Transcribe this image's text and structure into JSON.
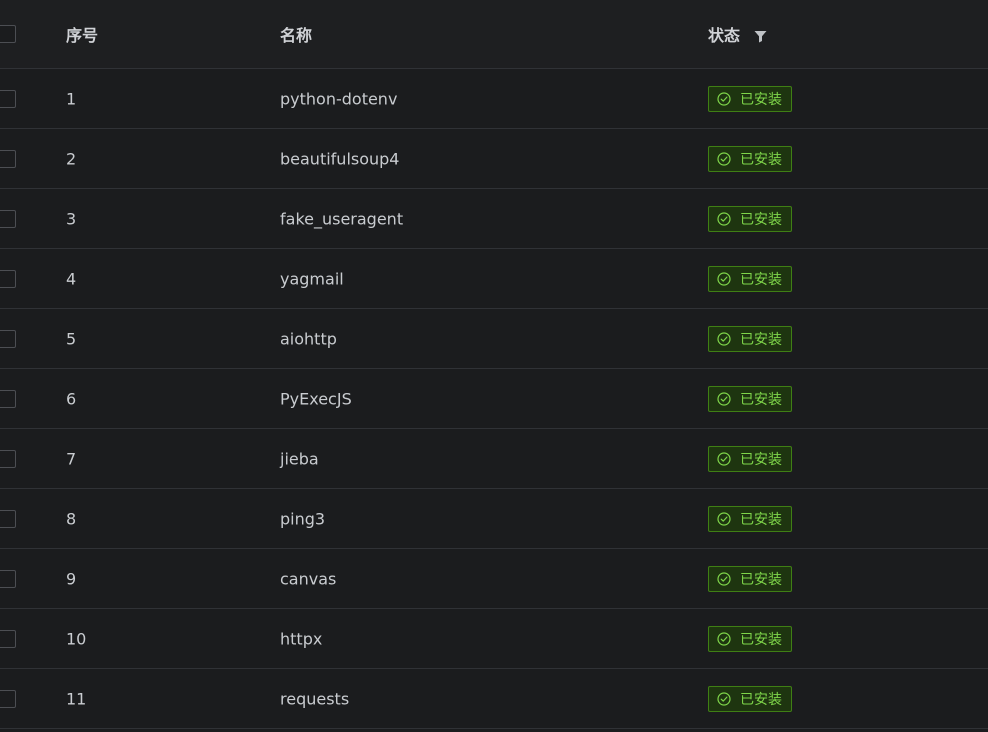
{
  "header": {
    "index_label": "序号",
    "name_label": "名称",
    "status_label": "状态"
  },
  "rows": [
    {
      "index": "1",
      "name": "python-dotenv",
      "status": "已安装"
    },
    {
      "index": "2",
      "name": "beautifulsoup4",
      "status": "已安装"
    },
    {
      "index": "3",
      "name": "fake_useragent",
      "status": "已安装"
    },
    {
      "index": "4",
      "name": "yagmail",
      "status": "已安装"
    },
    {
      "index": "5",
      "name": "aiohttp",
      "status": "已安装"
    },
    {
      "index": "6",
      "name": "PyExecJS",
      "status": "已安装"
    },
    {
      "index": "7",
      "name": "jieba",
      "status": "已安装"
    },
    {
      "index": "8",
      "name": "ping3",
      "status": "已安装"
    },
    {
      "index": "9",
      "name": "canvas",
      "status": "已安装"
    },
    {
      "index": "10",
      "name": "httpx",
      "status": "已安装"
    },
    {
      "index": "11",
      "name": "requests",
      "status": "已安装"
    }
  ],
  "icons": {
    "filter": "filter-icon",
    "status": "check-circle-icon"
  },
  "colors": {
    "background": "#1b1c1e",
    "success_text": "#7fd64a",
    "success_border": "#3f7f14",
    "success_bg": "#1e3510"
  }
}
